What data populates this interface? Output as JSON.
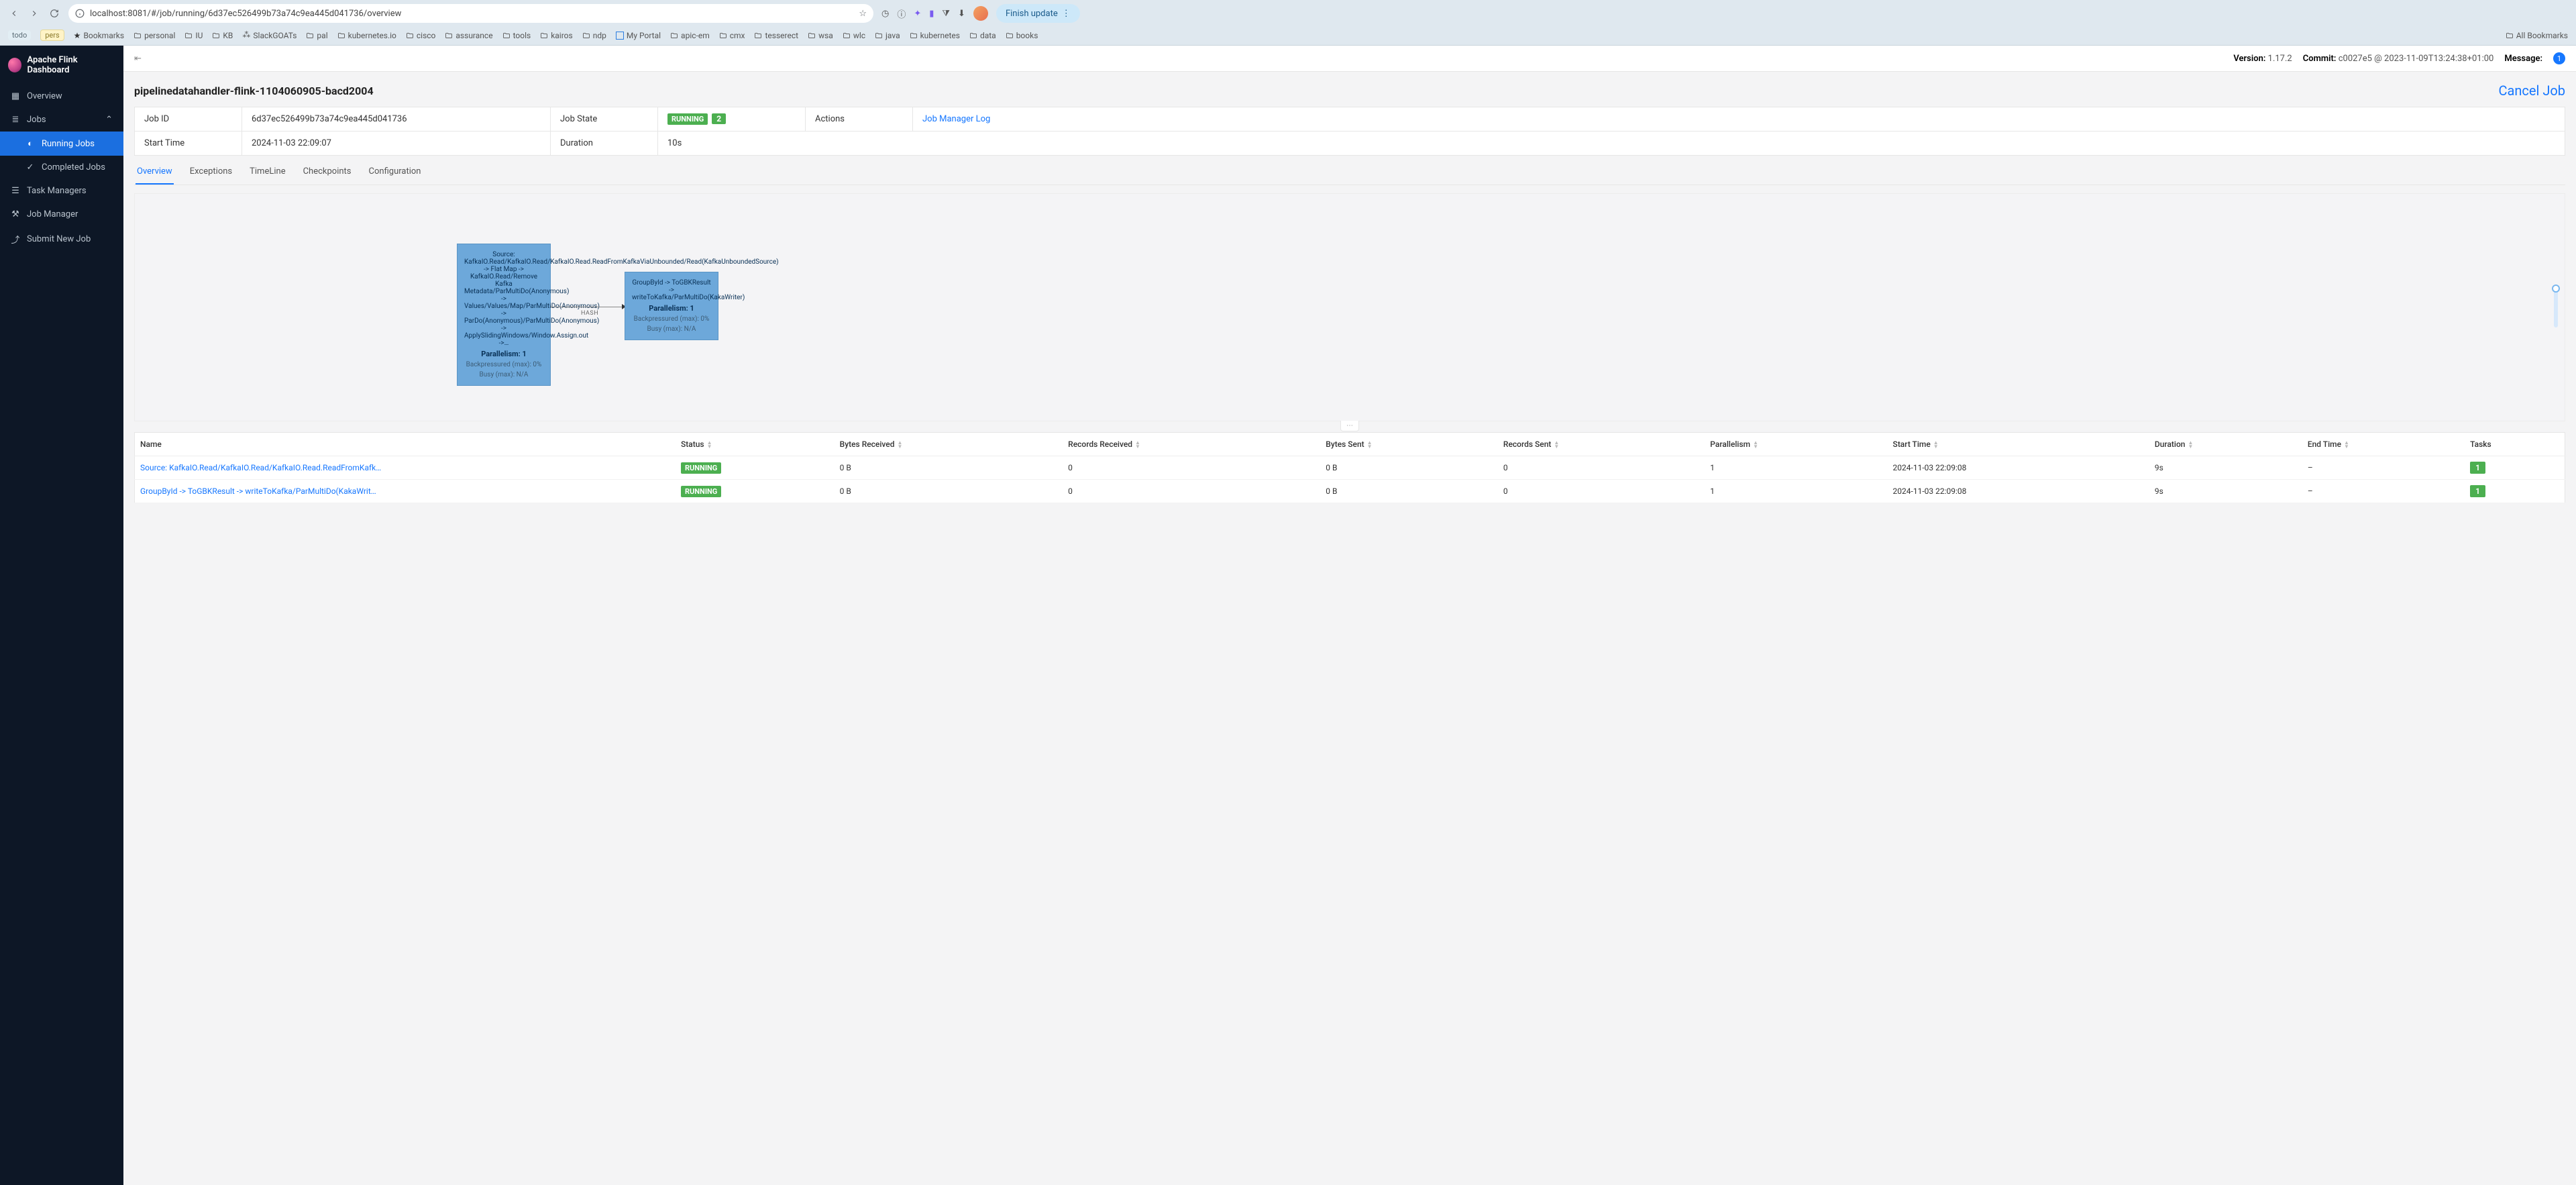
{
  "browser": {
    "url": "localhost:8081/#/job/running/6d37ec526499b73a74c9ea445d041736/overview",
    "finish": "Finish update",
    "all_bookmarks": "All Bookmarks",
    "bookmarks": [
      {
        "label": "todo",
        "type": "pill todo"
      },
      {
        "label": "pers",
        "type": "pill pers"
      },
      {
        "label": "Bookmarks",
        "type": "star"
      },
      {
        "label": "personal",
        "type": "folder"
      },
      {
        "label": "IU",
        "type": "folder"
      },
      {
        "label": "KB",
        "type": "folder"
      },
      {
        "label": "SlackGOATs",
        "type": "slack"
      },
      {
        "label": "pal",
        "type": "folder"
      },
      {
        "label": "kubernetes.io",
        "type": "folder"
      },
      {
        "label": "cisco",
        "type": "folder"
      },
      {
        "label": "assurance",
        "type": "folder"
      },
      {
        "label": "tools",
        "type": "folder"
      },
      {
        "label": "kairos",
        "type": "folder"
      },
      {
        "label": "ndp",
        "type": "folder"
      },
      {
        "label": "My Portal",
        "type": "portal"
      },
      {
        "label": "apic-em",
        "type": "folder"
      },
      {
        "label": "cmx",
        "type": "folder"
      },
      {
        "label": "tesserect",
        "type": "folder"
      },
      {
        "label": "wsa",
        "type": "folder"
      },
      {
        "label": "wlc",
        "type": "folder"
      },
      {
        "label": "java",
        "type": "folder"
      },
      {
        "label": "kubernetes",
        "type": "folder"
      },
      {
        "label": "data",
        "type": "folder"
      },
      {
        "label": "books",
        "type": "folder"
      }
    ]
  },
  "sidebar": {
    "title": "Apache Flink Dashboard",
    "overview": "Overview",
    "jobs": "Jobs",
    "running": "Running Jobs",
    "completed": "Completed Jobs",
    "tm": "Task Managers",
    "jm": "Job Manager",
    "submit": "Submit New Job"
  },
  "topbar": {
    "version_lbl": "Version:",
    "version": "1.17.2",
    "commit_lbl": "Commit:",
    "commit": "c0027e5 @ 2023-11-09T13:24:38+01:00",
    "message_lbl": "Message:",
    "message_count": "1"
  },
  "page": {
    "title": "pipelinedatahandler-flink-1104060905-bacd2004",
    "cancel": "Cancel Job"
  },
  "meta": {
    "jobid_lbl": "Job ID",
    "jobid": "6d37ec526499b73a74c9ea445d041736",
    "state_lbl": "Job State",
    "state": "RUNNING",
    "state_count": "2",
    "actions_lbl": "Actions",
    "jm_log": "Job Manager Log",
    "start_lbl": "Start Time",
    "start": "2024-11-03 22:09:07",
    "dur_lbl": "Duration",
    "dur": "10s"
  },
  "tabs": {
    "overview": "Overview",
    "exceptions": "Exceptions",
    "timeline": "TimeLine",
    "checkpoints": "Checkpoints",
    "config": "Configuration"
  },
  "graph": {
    "node1": "Source: KafkaIO.Read/KafkaIO.Read/KafkaIO.Read.ReadFromKafkaViaUnbounded/Read(KafkaUnboundedSource) -> Flat Map -> KafkaIO.Read/Remove Kafka Metadata/ParMultiDo(Anonymous) -> Values/Values/Map/ParMultiDo(Anonymous) -> ParDo(Anonymous)/ParMultiDo(Anonymous) -> ApplySlidingWindows/Window.Assign.out ->…",
    "node1_par": "Parallelism: 1",
    "node1_bp": "Backpressured (max): 0%",
    "node1_busy": "Busy (max): N/A",
    "node2": "GroupById -> ToGBKResult -> writeToKafka/ParMultiDo(KakaWriter)",
    "node2_par": "Parallelism: 1",
    "node2_bp": "Backpressured (max): 0%",
    "node2_busy": "Busy (max): N/A",
    "edge": "HASH"
  },
  "table": {
    "headers": {
      "name": "Name",
      "status": "Status",
      "br": "Bytes Received",
      "rr": "Records Received",
      "bs": "Bytes Sent",
      "rs": "Records Sent",
      "para": "Parallelism",
      "st": "Start Time",
      "dur": "Duration",
      "et": "End Time",
      "tasks": "Tasks"
    },
    "rows": [
      {
        "name": "Source: KafkaIO.Read/KafkaIO.Read/KafkaIO.Read.ReadFromKafk…",
        "status": "RUNNING",
        "br": "0 B",
        "rr": "0",
        "bs": "0 B",
        "rs": "0",
        "para": "1",
        "st": "2024-11-03 22:09:08",
        "dur": "9s",
        "et": "–",
        "tasks": "1"
      },
      {
        "name": "GroupById -> ToGBKResult -> writeToKafka/ParMultiDo(KakaWrit…",
        "status": "RUNNING",
        "br": "0 B",
        "rr": "0",
        "bs": "0 B",
        "rs": "0",
        "para": "1",
        "st": "2024-11-03 22:09:08",
        "dur": "9s",
        "et": "–",
        "tasks": "1"
      }
    ]
  }
}
